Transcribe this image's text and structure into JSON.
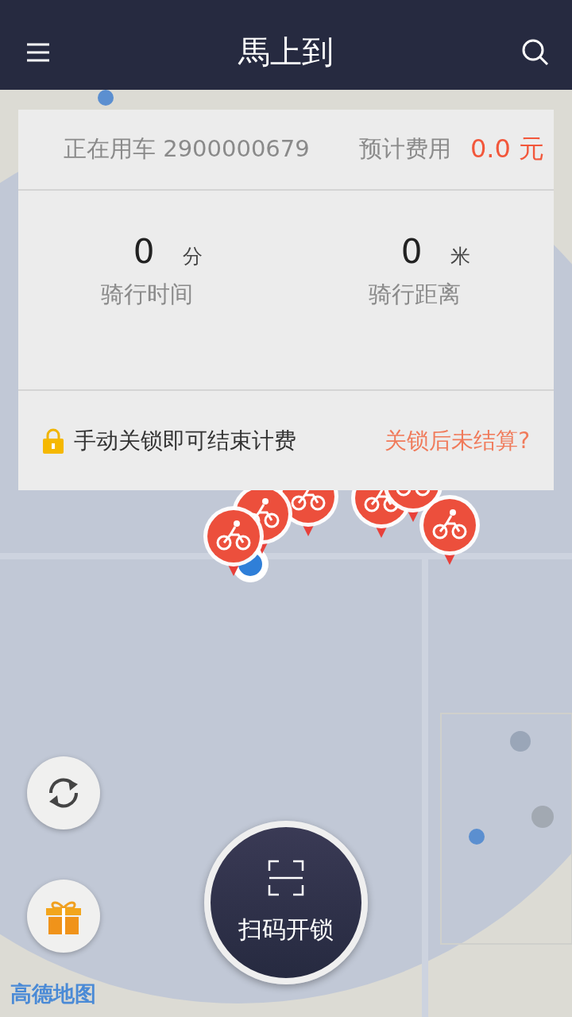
{
  "header": {
    "title": "馬上到"
  },
  "ride_card": {
    "ride_label": "正在用车",
    "bike_number": "2900000679",
    "fee_label": "预计费用",
    "fee": "0.0 元",
    "stats": [
      {
        "value": "0",
        "unit": "分",
        "label": "骑行时间"
      },
      {
        "value": "0",
        "unit": "米",
        "label": "骑行距离"
      }
    ],
    "hint": "手动关锁即可结束计费",
    "link": "关锁后未结算?"
  },
  "scan_button": {
    "label": "扫码开锁"
  },
  "map_logo": "高德地图"
}
